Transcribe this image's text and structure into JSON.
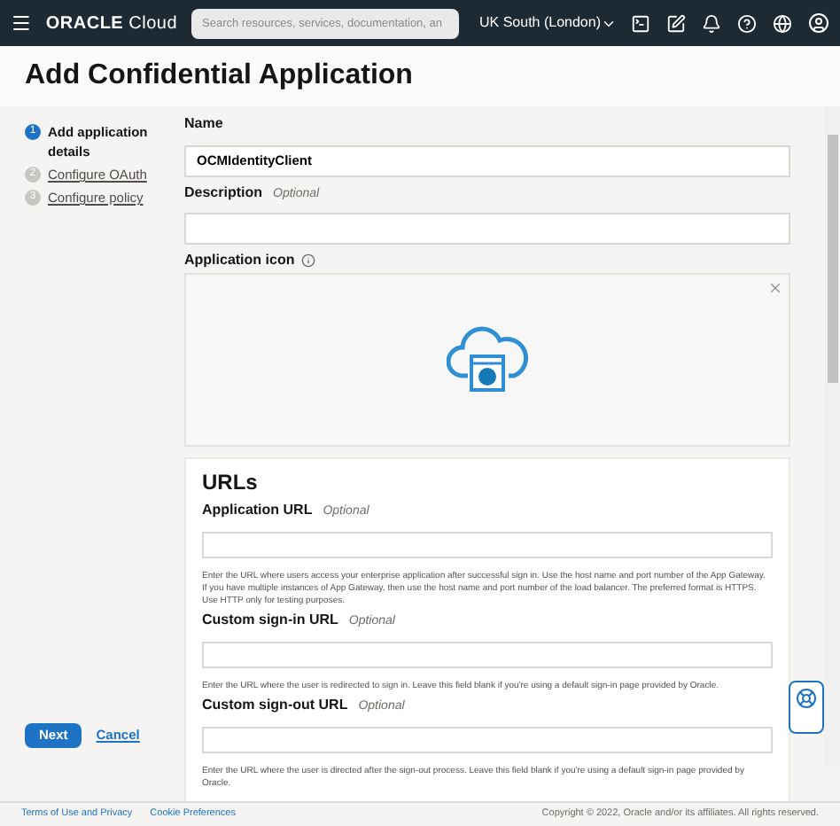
{
  "header": {
    "brand": "ORACLE",
    "product": "Cloud",
    "search": {
      "placeholder": "Search resources, services, documentation, an"
    },
    "region": "UK South (London)"
  },
  "page_title": "Add Confidential Application",
  "steps": [
    {
      "number": "1",
      "label": "Add application details",
      "selected": true
    },
    {
      "number": "2",
      "label": "Configure OAuth",
      "selected": false
    },
    {
      "number": "3",
      "label": "Configure policy",
      "selected": false
    }
  ],
  "form": {
    "name": {
      "label": "Name",
      "value": "OCMIdentityClient"
    },
    "description": {
      "label": "Description",
      "optional": "Optional"
    },
    "icon": {
      "label": "Application icon"
    }
  },
  "urls": {
    "title": "URLs",
    "fields": [
      {
        "label": "Application URL",
        "optional": "Optional",
        "help": "Enter the URL where users access your enterprise application after successful sign in. Use the host name and port number of the App Gateway. If you have multiple instances of App Gateway, then use the host name and port number of the load balancer. The preferred format is HTTPS. Use HTTP only for testing purposes."
      },
      {
        "label": "Custom sign-in URL",
        "optional": "Optional",
        "help": "Enter the URL where the user is redirected to sign in. Leave this field blank if you're using a default sign-in page provided by Oracle."
      },
      {
        "label": "Custom sign-out URL",
        "optional": "Optional",
        "help": "Enter the URL where the user is directed after the sign-out process. Leave this field blank if you're using a default sign-in page provided by Oracle."
      }
    ]
  },
  "actions": {
    "next": "Next",
    "cancel": "Cancel"
  },
  "footer": {
    "links": [
      "Terms of Use and Privacy",
      "Cookie Preferences"
    ],
    "copyright": "Copyright © 2022, Oracle and/or its affiliates. All rights reserved."
  }
}
